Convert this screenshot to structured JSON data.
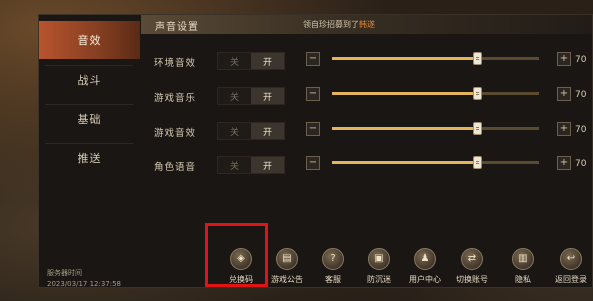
{
  "nav": {
    "items": [
      {
        "label": "音效",
        "active": true
      },
      {
        "label": "战斗",
        "active": false
      },
      {
        "label": "基础",
        "active": false
      },
      {
        "label": "推送",
        "active": false
      }
    ]
  },
  "header": {
    "title": "声音设置",
    "note_prefix": "领自珍招募到了",
    "note_highlight": "韩遂"
  },
  "settings": [
    {
      "label": "环境音效",
      "off": "关",
      "on": "开",
      "value": "70",
      "level": 0.7
    },
    {
      "label": "游戏音乐",
      "off": "关",
      "on": "开",
      "value": "70",
      "level": 0.7
    },
    {
      "label": "游戏音效",
      "off": "关",
      "on": "开",
      "value": "70",
      "level": 0.7
    },
    {
      "label": "角色语音",
      "off": "关",
      "on": "开",
      "value": "70",
      "level": 0.7
    }
  ],
  "controls": {
    "minus": "−",
    "plus": "+"
  },
  "server": {
    "label": "服务器时间",
    "time": "2023/03/17 12:37:58"
  },
  "tools": [
    {
      "label": "兑换码",
      "icon": "gift-bag-icon",
      "glyph": "◈"
    },
    {
      "label": "游戏公告",
      "icon": "notice-icon",
      "glyph": "▤"
    },
    {
      "label": "客服",
      "icon": "customer-service-icon",
      "glyph": "?"
    },
    {
      "label": "防沉迷",
      "icon": "anti-addiction-icon",
      "glyph": "▣"
    },
    {
      "label": "用户中心",
      "icon": "user-center-icon",
      "glyph": "♟"
    },
    {
      "label": "切换账号",
      "icon": "switch-account-icon",
      "glyph": "⇄"
    },
    {
      "label": "隐私",
      "icon": "privacy-icon",
      "glyph": "▥"
    },
    {
      "label": "返回登录",
      "icon": "return-login-icon",
      "glyph": "↩"
    }
  ],
  "colors": {
    "accent": "#b8542e",
    "slider": "#e3b45a",
    "highlight": "#e01414"
  }
}
